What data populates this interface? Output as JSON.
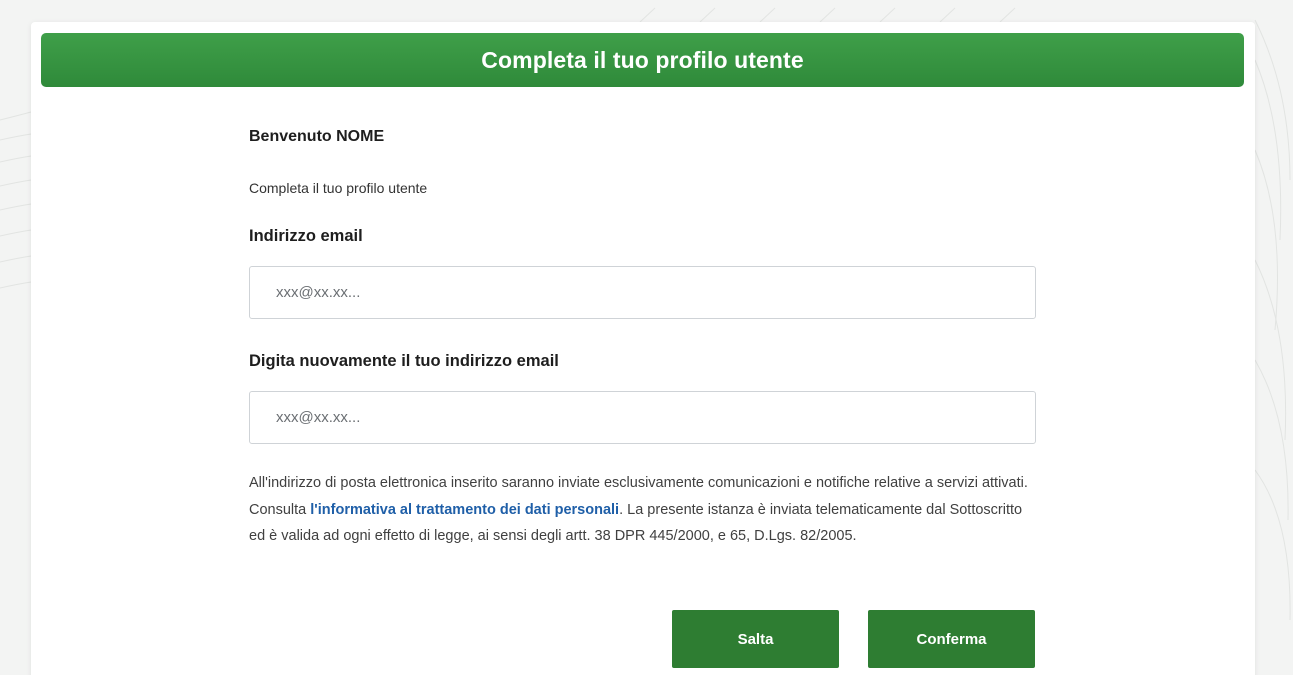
{
  "header": {
    "title": "Completa il tuo profilo utente"
  },
  "form": {
    "welcome_prefix": "Benvenuto",
    "welcome_name": "NOME",
    "subtitle": "Completa il tuo profilo utente",
    "email_label": "Indirizzo email",
    "email_placeholder": "xxx@xx.xx...",
    "email_value": "",
    "confirm_label": "Digita nuovamente il tuo indirizzo email",
    "confirm_placeholder": "xxx@xx.xx...",
    "confirm_value": ""
  },
  "notice": {
    "text_before_link": "All'indirizzo di posta elettronica inserito saranno inviate esclusivamente comunicazioni e notifiche relative a servizi attivati. Consulta ",
    "link_text": "l'informativa al trattamento dei dati personali",
    "text_after_link": ". La presente istanza è inviata telematicamente dal Sottoscritto ed è valida ad ogni effetto di legge, ai sensi degli artt. 38 DPR 445/2000, e 65, D.Lgs. 82/2005."
  },
  "buttons": {
    "skip_label": "Salta",
    "confirm_label": "Conferma"
  },
  "colors": {
    "header_green": "#3f9f49",
    "button_green": "#2e7d32",
    "link_blue": "#1f5fa8"
  }
}
